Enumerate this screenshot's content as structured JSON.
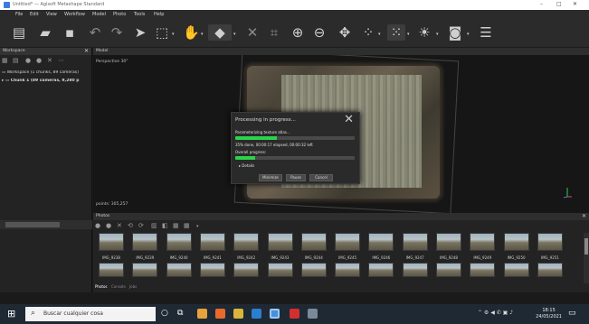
{
  "window": {
    "title": "Untitled* — Agisoft Metashape Standard",
    "controls": [
      "–",
      "□",
      "✕"
    ]
  },
  "menu": [
    "File",
    "Edit",
    "View",
    "Workflow",
    "Model",
    "Photo",
    "Tools",
    "Help"
  ],
  "toolbar": {
    "icons": [
      "new-file-icon",
      "open-folder-icon",
      "save-icon",
      "undo-icon",
      "redo-icon",
      "select-pointer-icon",
      "rectangle-selection-icon",
      "navigation-icon",
      "shape-icon",
      "delete-icon",
      "crop-icon",
      "zoom-in-icon",
      "zoom-out-icon",
      "move-icon",
      "view-points-icon",
      "view-mesh-icon",
      "lighting-icon",
      "camera-icon",
      "display-layers-icon"
    ]
  },
  "workspace": {
    "panel_title": "Workspace",
    "root_label": "Workspace (1 chunks, 89 cameras)",
    "chunk_label": "Chunk 1 (89 cameras, 9,280 p"
  },
  "model": {
    "panel_title": "Model",
    "view_label": "Perspective 30°",
    "points_label": "points: 305,257"
  },
  "dialog": {
    "title": "Processing in progress...",
    "task_label": "Parameterizing texture atlas...",
    "task_progress": 35,
    "task_status": "35% done, 00:00:17 elapsed, 00:00:32 left",
    "overall_label": "Overall progress:",
    "overall_progress": 17,
    "details_label": "Details",
    "buttons": [
      "Minimize",
      "Pause",
      "Cancel"
    ],
    "accent": "#2bd34b"
  },
  "photos": {
    "panel_title": "Photos",
    "thumbnails": [
      "IMG_9238",
      "IMG_9239",
      "IMG_9240",
      "IMG_9241",
      "IMG_9242",
      "IMG_9243",
      "IMG_9244",
      "IMG_9245",
      "IMG_9246",
      "IMG_9247",
      "IMG_9248",
      "IMG_9249",
      "IMG_9250",
      "IMG_9251"
    ],
    "bottom_tabs": [
      "Photos",
      "Console",
      "Jobs"
    ]
  },
  "taskbar": {
    "search_placeholder": "Buscar cualquier cosa",
    "time": "18:15",
    "date": "24/05/2021"
  }
}
